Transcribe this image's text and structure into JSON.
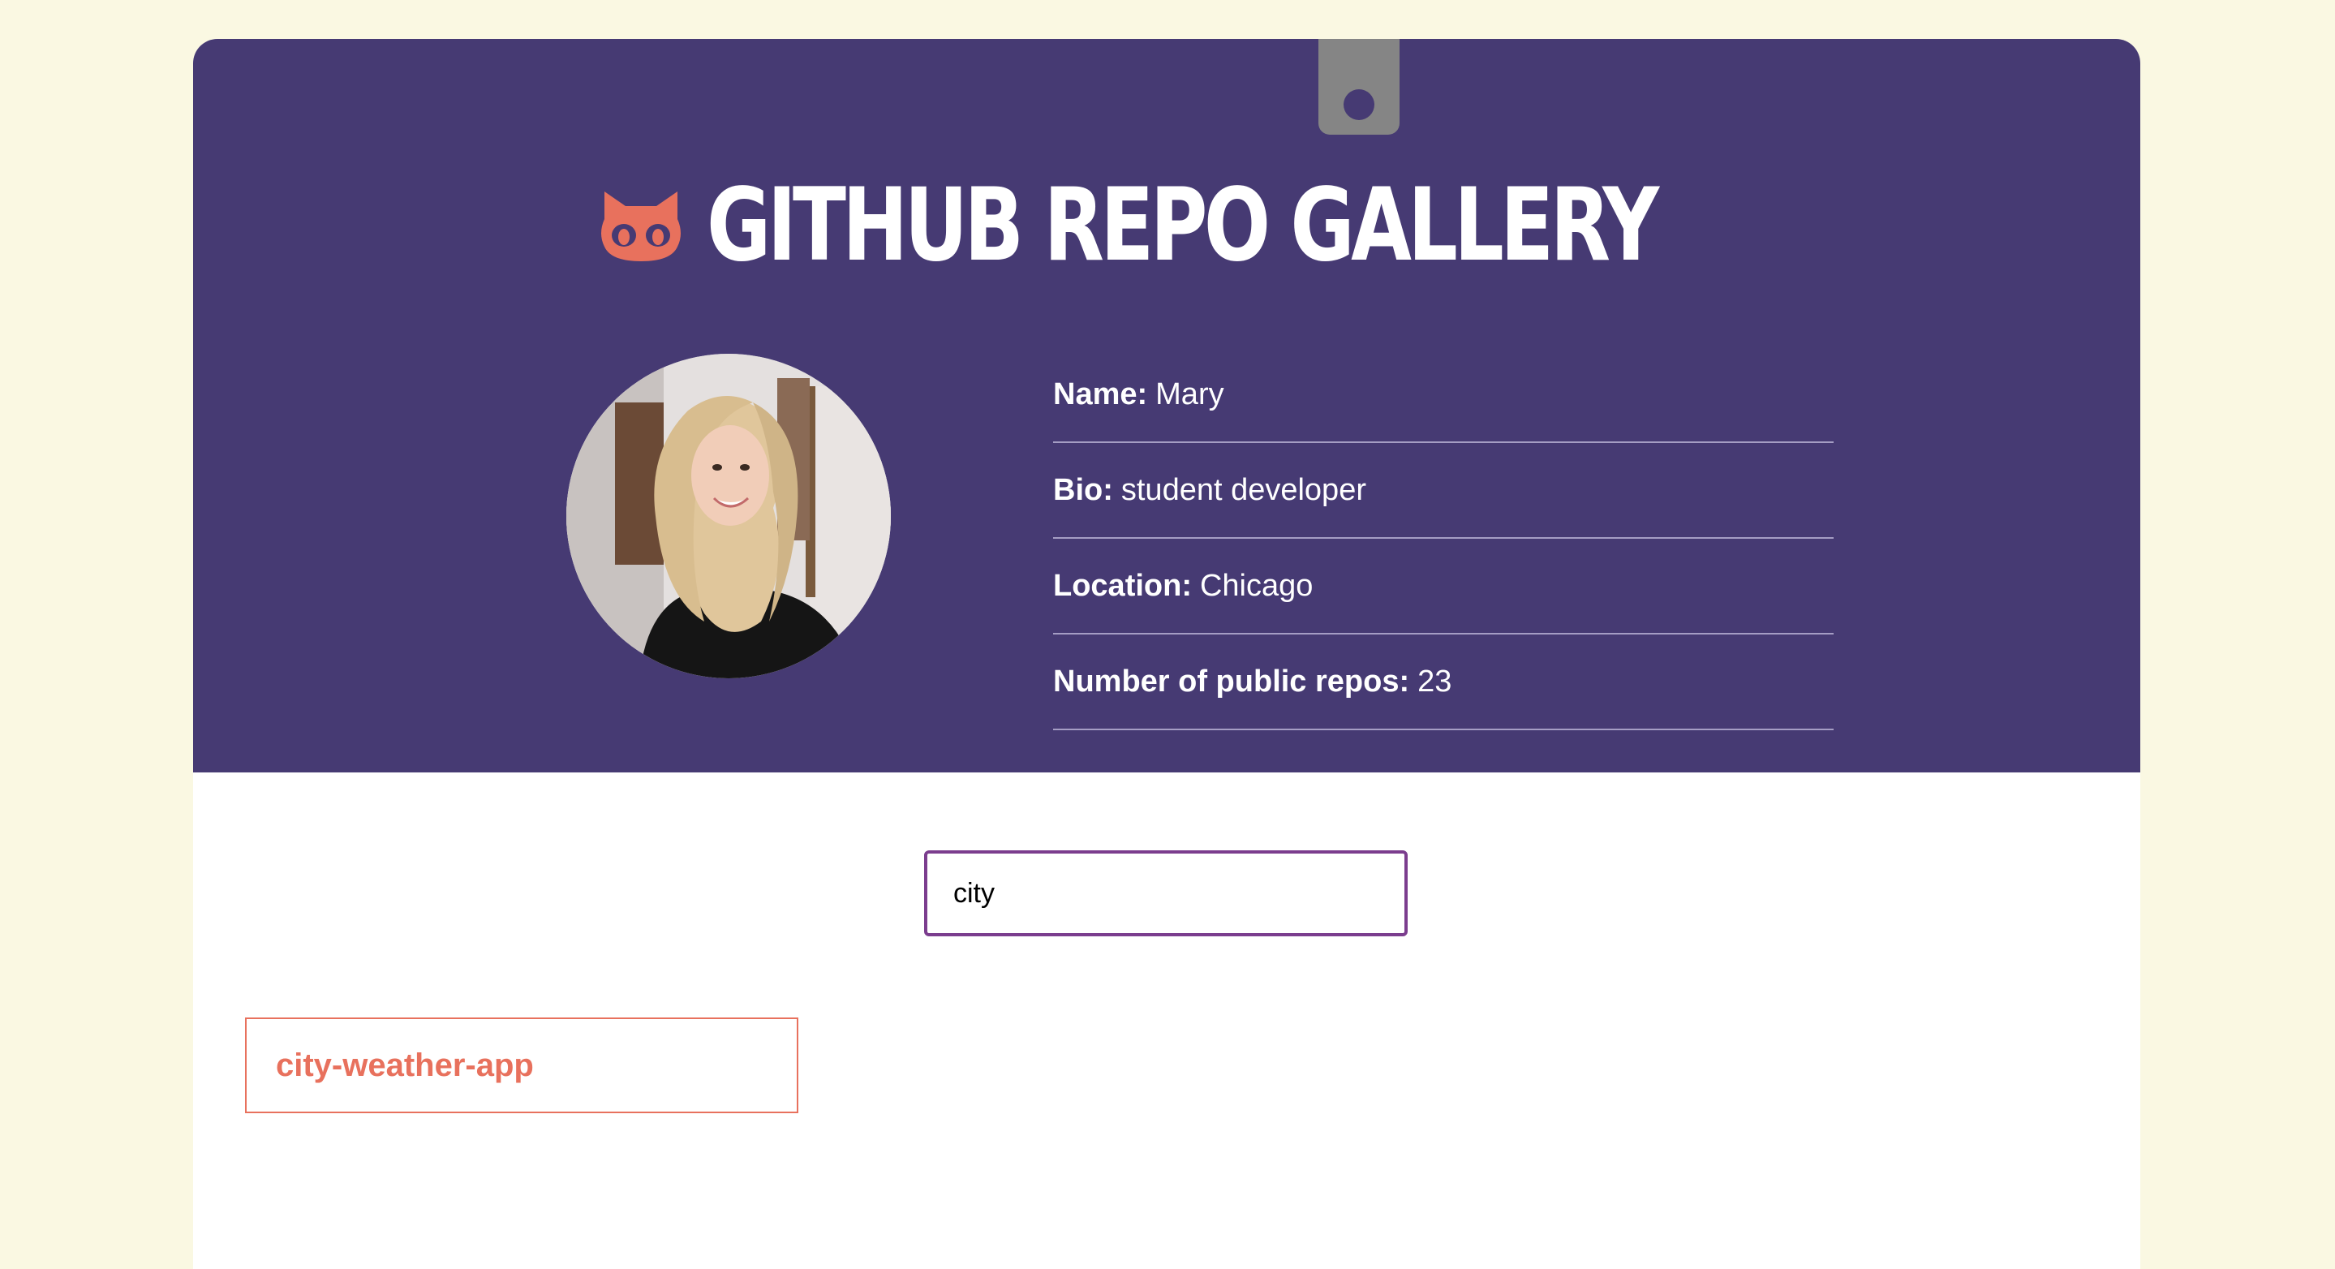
{
  "header": {
    "title": "GITHUB REPO GALLERY",
    "logo_icon": "octocat-icon"
  },
  "profile": {
    "avatar": "user-photo",
    "fields": [
      {
        "label": "Name:",
        "value": "Mary"
      },
      {
        "label": "Bio:",
        "value": "student developer"
      },
      {
        "label": "Location:",
        "value": "Chicago"
      },
      {
        "label": "Number of public repos:",
        "value": "23"
      }
    ]
  },
  "search": {
    "value": "city",
    "placeholder": ""
  },
  "repos": [
    {
      "name": "city-weather-app"
    }
  ],
  "colors": {
    "background": "#faf8e2",
    "header": "#463a73",
    "accent": "#e8715d",
    "search_border": "#7b3d8e",
    "clip": "#858585"
  }
}
